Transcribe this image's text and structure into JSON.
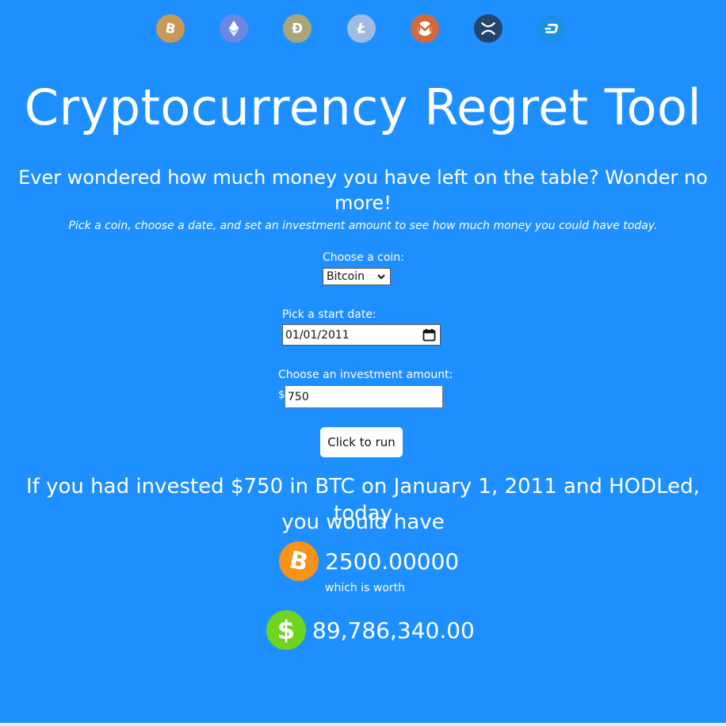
{
  "coins": [
    {
      "name": "Bitcoin",
      "icon": "bitcoin-icon",
      "color": "#c8985a"
    },
    {
      "name": "Ethereum",
      "icon": "ethereum-icon",
      "color": "#6a87e4"
    },
    {
      "name": "Dogecoin",
      "icon": "dogecoin-icon",
      "color": "#a6a67a"
    },
    {
      "name": "Litecoin",
      "icon": "litecoin-icon",
      "color": "#9fbbe2"
    },
    {
      "name": "Monero",
      "icon": "monero-icon",
      "color": "#d46a3c"
    },
    {
      "name": "XRP",
      "icon": "xrp-icon",
      "color": "#24456e"
    },
    {
      "name": "Dash",
      "icon": "dash-icon",
      "color": "#1c8fe6"
    }
  ],
  "header": {
    "title": "Cryptocurrency Regret Tool",
    "subtitle": "Ever wondered how much money you have left on the table? Wonder no more!",
    "hint": "Pick a coin, choose a date, and set an investment amount to see how much money you could have today."
  },
  "form": {
    "coin_label": "Choose a coin:",
    "coin_value": "Bitcoin",
    "date_label": "Pick a start date:",
    "date_value": "01/01/2011",
    "amount_label": "Choose an investment amount:",
    "currency_prefix": "$",
    "amount_value": "750",
    "run_label": "Click to run"
  },
  "result": {
    "line1": "If you had invested $750 in BTC on January 1, 2011 and HODLed, today",
    "line2": "you would have",
    "coin_amount": "2500.00000",
    "worth_text": "which is worth",
    "usd_amount": "89,786,340.00"
  },
  "colors": {
    "background": "#1e8fff",
    "btc_orange": "#f7931a",
    "usd_green": "#6fd41f"
  }
}
